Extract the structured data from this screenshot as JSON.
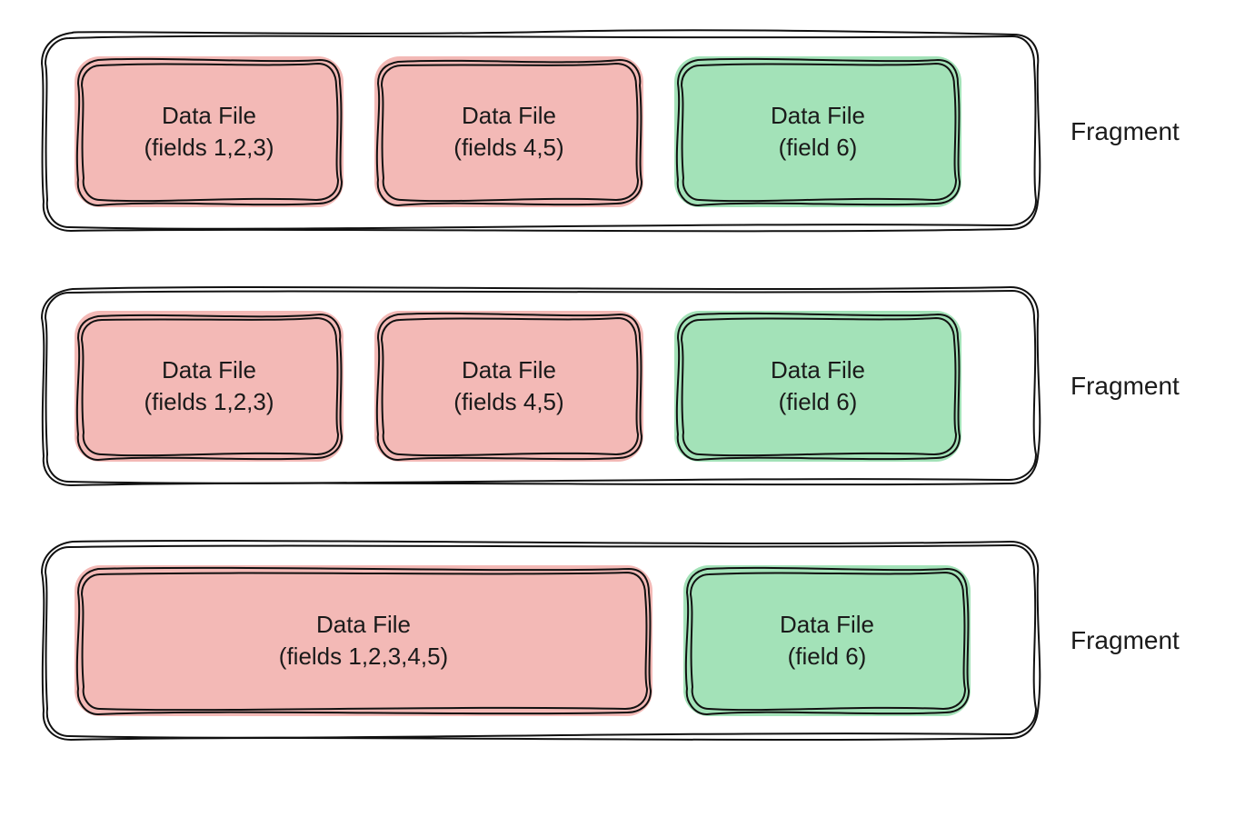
{
  "colors": {
    "red": "#f3b9b6",
    "green": "#a3e2b8",
    "stroke": "#111111"
  },
  "side_label": "Fragment",
  "fragments": [
    {
      "boxes": [
        {
          "title": "Data File",
          "subtitle": "(fields 1,2,3)",
          "color": "red",
          "size": "small"
        },
        {
          "title": "Data File",
          "subtitle": "(fields 4,5)",
          "color": "red",
          "size": "medium"
        },
        {
          "title": "Data File",
          "subtitle": "(field 6)",
          "color": "green",
          "size": "last"
        }
      ]
    },
    {
      "boxes": [
        {
          "title": "Data File",
          "subtitle": "(fields 1,2,3)",
          "color": "red",
          "size": "small"
        },
        {
          "title": "Data File",
          "subtitle": "(fields 4,5)",
          "color": "red",
          "size": "medium"
        },
        {
          "title": "Data File",
          "subtitle": "(field 6)",
          "color": "green",
          "size": "last"
        }
      ]
    },
    {
      "boxes": [
        {
          "title": "Data File",
          "subtitle": "(fields 1,2,3,4,5)",
          "color": "red",
          "size": "wide"
        },
        {
          "title": "Data File",
          "subtitle": "(field 6)",
          "color": "green",
          "size": "last"
        }
      ]
    }
  ]
}
